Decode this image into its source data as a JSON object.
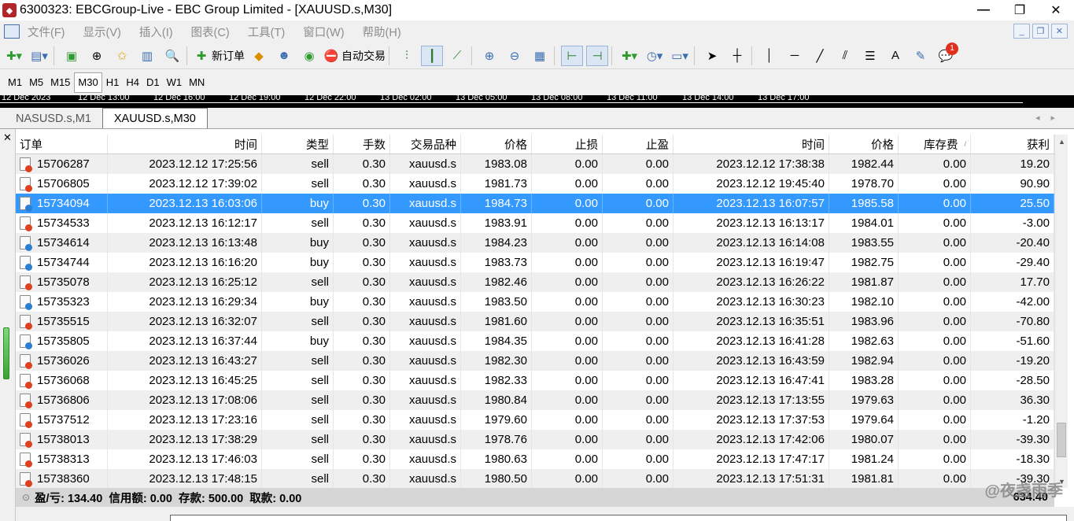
{
  "window": {
    "title": "6300323: EBCGroup-Live - EBC Group Limited - [XAUUSD.s,M30]",
    "app_icon": "mt4-icon"
  },
  "menu": {
    "items": [
      "文件(F)",
      "显示(V)",
      "插入(I)",
      "图表(C)",
      "工具(T)",
      "窗口(W)",
      "帮助(H)"
    ]
  },
  "toolbar": {
    "new_order": "新订单",
    "auto_trade": "自动交易",
    "notification_count": "1"
  },
  "timeframes": {
    "items": [
      "M1",
      "M5",
      "M15",
      "M30",
      "H1",
      "H4",
      "D1",
      "W1",
      "MN"
    ],
    "active": "M30"
  },
  "chart_axis": {
    "labels": [
      "12 Dec 2023",
      "12 Dec 13:00",
      "12 Dec 16:00",
      "12 Dec 19:00",
      "12 Dec 22:00",
      "13 Dec 02:00",
      "13 Dec 05:00",
      "13 Dec 08:00",
      "13 Dec 11:00",
      "13 Dec 14:00",
      "13 Dec 17:00"
    ]
  },
  "tabs": {
    "items": [
      "NASUSD.s,M1",
      "XAUUSD.s,M30"
    ],
    "active": "XAUUSD.s,M30"
  },
  "table": {
    "headers": [
      "订单",
      "时间",
      "类型",
      "手数",
      "交易品种",
      "价格",
      "止损",
      "止盈",
      "时间",
      "价格",
      "库存费",
      "获利"
    ],
    "rows": [
      [
        "15706287",
        "2023.12.12 17:25:56",
        "sell",
        "0.30",
        "xauusd.s",
        "1983.08",
        "0.00",
        "0.00",
        "2023.12.12 17:38:38",
        "1982.44",
        "0.00",
        "19.20"
      ],
      [
        "15706805",
        "2023.12.12 17:39:02",
        "sell",
        "0.30",
        "xauusd.s",
        "1981.73",
        "0.00",
        "0.00",
        "2023.12.12 19:45:40",
        "1978.70",
        "0.00",
        "90.90"
      ],
      [
        "15734094",
        "2023.12.13 16:03:06",
        "buy",
        "0.30",
        "xauusd.s",
        "1984.73",
        "0.00",
        "0.00",
        "2023.12.13 16:07:57",
        "1985.58",
        "0.00",
        "25.50"
      ],
      [
        "15734533",
        "2023.12.13 16:12:17",
        "sell",
        "0.30",
        "xauusd.s",
        "1983.91",
        "0.00",
        "0.00",
        "2023.12.13 16:13:17",
        "1984.01",
        "0.00",
        "-3.00"
      ],
      [
        "15734614",
        "2023.12.13 16:13:48",
        "buy",
        "0.30",
        "xauusd.s",
        "1984.23",
        "0.00",
        "0.00",
        "2023.12.13 16:14:08",
        "1983.55",
        "0.00",
        "-20.40"
      ],
      [
        "15734744",
        "2023.12.13 16:16:20",
        "buy",
        "0.30",
        "xauusd.s",
        "1983.73",
        "0.00",
        "0.00",
        "2023.12.13 16:19:47",
        "1982.75",
        "0.00",
        "-29.40"
      ],
      [
        "15735078",
        "2023.12.13 16:25:12",
        "sell",
        "0.30",
        "xauusd.s",
        "1982.46",
        "0.00",
        "0.00",
        "2023.12.13 16:26:22",
        "1981.87",
        "0.00",
        "17.70"
      ],
      [
        "15735323",
        "2023.12.13 16:29:34",
        "buy",
        "0.30",
        "xauusd.s",
        "1983.50",
        "0.00",
        "0.00",
        "2023.12.13 16:30:23",
        "1982.10",
        "0.00",
        "-42.00"
      ],
      [
        "15735515",
        "2023.12.13 16:32:07",
        "sell",
        "0.30",
        "xauusd.s",
        "1981.60",
        "0.00",
        "0.00",
        "2023.12.13 16:35:51",
        "1983.96",
        "0.00",
        "-70.80"
      ],
      [
        "15735805",
        "2023.12.13 16:37:44",
        "buy",
        "0.30",
        "xauusd.s",
        "1984.35",
        "0.00",
        "0.00",
        "2023.12.13 16:41:28",
        "1982.63",
        "0.00",
        "-51.60"
      ],
      [
        "15736026",
        "2023.12.13 16:43:27",
        "sell",
        "0.30",
        "xauusd.s",
        "1982.30",
        "0.00",
        "0.00",
        "2023.12.13 16:43:59",
        "1982.94",
        "0.00",
        "-19.20"
      ],
      [
        "15736068",
        "2023.12.13 16:45:25",
        "sell",
        "0.30",
        "xauusd.s",
        "1982.33",
        "0.00",
        "0.00",
        "2023.12.13 16:47:41",
        "1983.28",
        "0.00",
        "-28.50"
      ],
      [
        "15736806",
        "2023.12.13 17:08:06",
        "sell",
        "0.30",
        "xauusd.s",
        "1980.84",
        "0.00",
        "0.00",
        "2023.12.13 17:13:55",
        "1979.63",
        "0.00",
        "36.30"
      ],
      [
        "15737512",
        "2023.12.13 17:23:16",
        "sell",
        "0.30",
        "xauusd.s",
        "1979.60",
        "0.00",
        "0.00",
        "2023.12.13 17:37:53",
        "1979.64",
        "0.00",
        "-1.20"
      ],
      [
        "15738013",
        "2023.12.13 17:38:29",
        "sell",
        "0.30",
        "xauusd.s",
        "1978.76",
        "0.00",
        "0.00",
        "2023.12.13 17:42:06",
        "1980.07",
        "0.00",
        "-39.30"
      ],
      [
        "15738313",
        "2023.12.13 17:46:03",
        "sell",
        "0.30",
        "xauusd.s",
        "1980.63",
        "0.00",
        "0.00",
        "2023.12.13 17:47:17",
        "1981.24",
        "0.00",
        "-18.30"
      ],
      [
        "15738360",
        "2023.12.13 17:48:15",
        "sell",
        "0.30",
        "xauusd.s",
        "1980.50",
        "0.00",
        "0.00",
        "2023.12.13 17:51:31",
        "1981.81",
        "0.00",
        "-39.30"
      ]
    ],
    "selected_row": 2
  },
  "summary": {
    "text": "盈/亏: 134.40  信用额: 0.00  存款: 500.00  取款: 0.00",
    "total": "634.40"
  },
  "watermark": "@夜盏雨季",
  "colors": {
    "selected": "#3399ff",
    "sell_dot": "#e0401f",
    "buy_dot": "#2a7fd4"
  }
}
